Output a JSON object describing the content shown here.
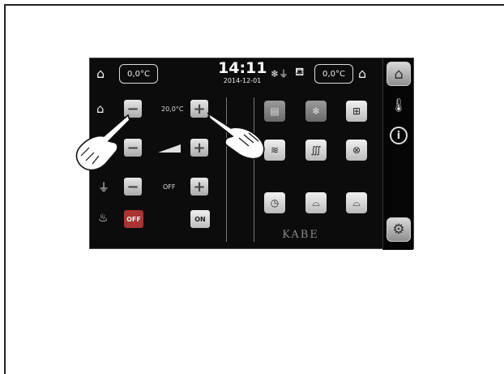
{
  "topbar": {
    "inside_temp": "0,0°C",
    "time": "14:11",
    "date": "2014-12-01",
    "outside_temp": "0,0°C"
  },
  "heating": {
    "setpoint": "20,0°C",
    "row3_value": "OFF",
    "off_label": "OFF",
    "on_label": "ON"
  },
  "brand": "KABE",
  "icons": {
    "sidebar": [
      "home-icon",
      "thermometer-icon",
      "info-icon",
      "gear-icon"
    ],
    "tiles": [
      "heater-icon",
      "snow-electric-icon",
      "ac-electric-icon",
      "heated-floor-icon",
      "heating-coil-icon",
      "circulation-icon",
      "clock-thermometer-icon",
      "seat-icon",
      "seat-icon"
    ]
  }
}
